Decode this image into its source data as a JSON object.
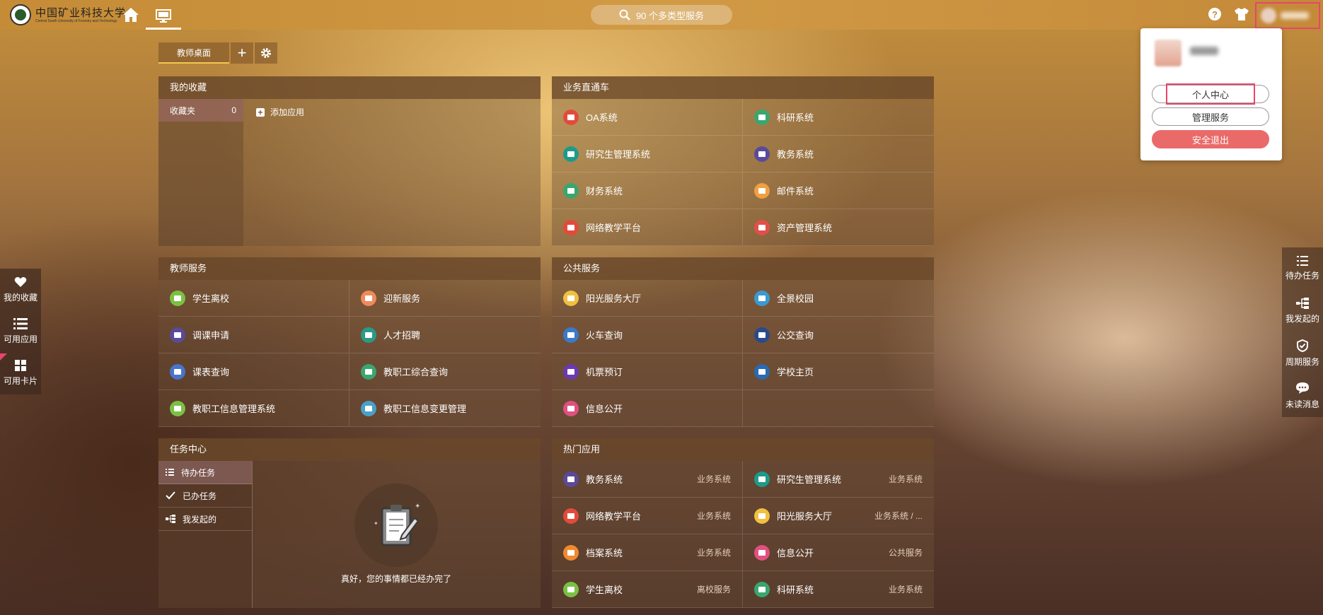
{
  "topbar": {
    "logo_cn": "中国矿业科技大学",
    "logo_en": "Central South University of Forestry and Technology",
    "search_text": "90 个多类型服务"
  },
  "user_menu": {
    "personal_center": "个人中心",
    "admin_service": "管理服务",
    "logout": "安全退出"
  },
  "tabs": {
    "active": "教师桌面"
  },
  "favorites": {
    "title": "我的收藏",
    "folder_label": "收藏夹",
    "folder_count": "0",
    "add_app": "添加应用"
  },
  "business": {
    "title": "业务直通车",
    "items": [
      {
        "label": "OA系统",
        "color": "#e24b3b"
      },
      {
        "label": "科研系统",
        "color": "#3aa66f"
      },
      {
        "label": "研究生管理系统",
        "color": "#1e9a8a"
      },
      {
        "label": "教务系统",
        "color": "#5b4a9a"
      },
      {
        "label": "财务系统",
        "color": "#3aa66f"
      },
      {
        "label": "邮件系统",
        "color": "#f0a040"
      },
      {
        "label": "网络教学平台",
        "color": "#e24b3b"
      },
      {
        "label": "资产管理系统",
        "color": "#e0504a"
      }
    ]
  },
  "teacher": {
    "title": "教师服务",
    "items": [
      {
        "label": "学生离校",
        "color": "#7bc043"
      },
      {
        "label": "迎新服务",
        "color": "#f08a5d"
      },
      {
        "label": "调课申请",
        "color": "#5b4a9a"
      },
      {
        "label": "人才招聘",
        "color": "#2a9a88"
      },
      {
        "label": "课表查询",
        "color": "#4a74c9"
      },
      {
        "label": "教职工综合查询",
        "color": "#3aa66f"
      },
      {
        "label": "教职工信息管理系统",
        "color": "#7bc043"
      },
      {
        "label": "教职工信息变更管理",
        "color": "#4aa0c9"
      }
    ]
  },
  "public": {
    "title": "公共服务",
    "items": [
      {
        "label": "阳光服务大厅",
        "color": "#f0c040"
      },
      {
        "label": "全景校园",
        "color": "#3a9ad0"
      },
      {
        "label": "火车查询",
        "color": "#3a7ac9"
      },
      {
        "label": "公交查询",
        "color": "#2a4a8a"
      },
      {
        "label": "机票预订",
        "color": "#6a3ab0"
      },
      {
        "label": "学校主页",
        "color": "#2a6ab0"
      },
      {
        "label": "信息公开",
        "color": "#e05080"
      },
      {
        "label": "",
        "color": ""
      }
    ]
  },
  "tasks": {
    "title": "任务中心",
    "items": [
      "待办任务",
      "已办任务",
      "我发起的"
    ],
    "empty_message": "真好，您的事情都已经办完了"
  },
  "hot": {
    "title": "热门应用",
    "items": [
      {
        "label": "教务系统",
        "category": "业务系统",
        "color": "#5b4a9a"
      },
      {
        "label": "研究生管理系统",
        "category": "业务系统",
        "color": "#1e9a8a"
      },
      {
        "label": "网络教学平台",
        "category": "业务系统",
        "color": "#e24b3b"
      },
      {
        "label": "阳光服务大厅",
        "category": "业务系统 / ...",
        "color": "#f0c040"
      },
      {
        "label": "档案系统",
        "category": "业务系统",
        "color": "#f08a30"
      },
      {
        "label": "信息公开",
        "category": "公共服务",
        "color": "#e05080"
      },
      {
        "label": "学生离校",
        "category": "离校服务",
        "color": "#7bc043"
      },
      {
        "label": "科研系统",
        "category": "业务系统",
        "color": "#3aa66f"
      }
    ]
  },
  "left_dock": [
    "我的收藏",
    "可用应用",
    "可用卡片"
  ],
  "right_dock": [
    "待办任务",
    "我发起的",
    "周期服务",
    "未读消息"
  ]
}
